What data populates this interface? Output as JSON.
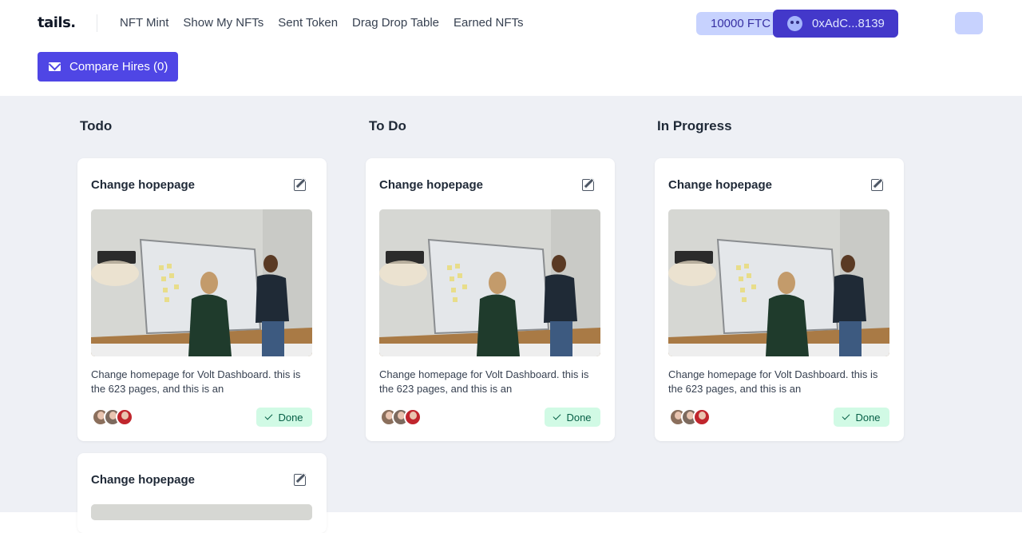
{
  "header": {
    "logo": "tails.",
    "nav": [
      "NFT Mint",
      "Show My NFTs",
      "Sent Token",
      "Drag Drop Table",
      "Earned NFTs"
    ],
    "balance": "10000 FTC",
    "wallet": "0xAdC...8139",
    "wallet_icon": "robot-avatar-icon",
    "menu_button_icon": "blank"
  },
  "toolbar": {
    "compare_label": "Compare Hires (0)",
    "compare_icon": "mail-icon"
  },
  "colors": {
    "accent": "#4f46e5",
    "accent_light": "#c7d2fe",
    "board_bg": "#eef0f5",
    "done_bg": "#d1fae5",
    "done_text": "#065f46"
  },
  "columns": [
    {
      "title": "Todo",
      "cards": [
        {
          "title": "Change hopepage",
          "description": "Change homepage for Volt Dashboard. this is the 623 pages, and this is an",
          "status": "Done"
        },
        {
          "title": "Change hopepage",
          "description": "",
          "status": ""
        }
      ]
    },
    {
      "title": "To Do",
      "cards": [
        {
          "title": "Change hopepage",
          "description": "Change homepage for Volt Dashboard. this is the 623 pages, and this is an",
          "status": "Done"
        }
      ]
    },
    {
      "title": "In Progress",
      "cards": [
        {
          "title": "Change hopepage",
          "description": "Change homepage for Volt Dashboard. this is the 623 pages, and this is an",
          "status": "Done"
        }
      ]
    }
  ]
}
